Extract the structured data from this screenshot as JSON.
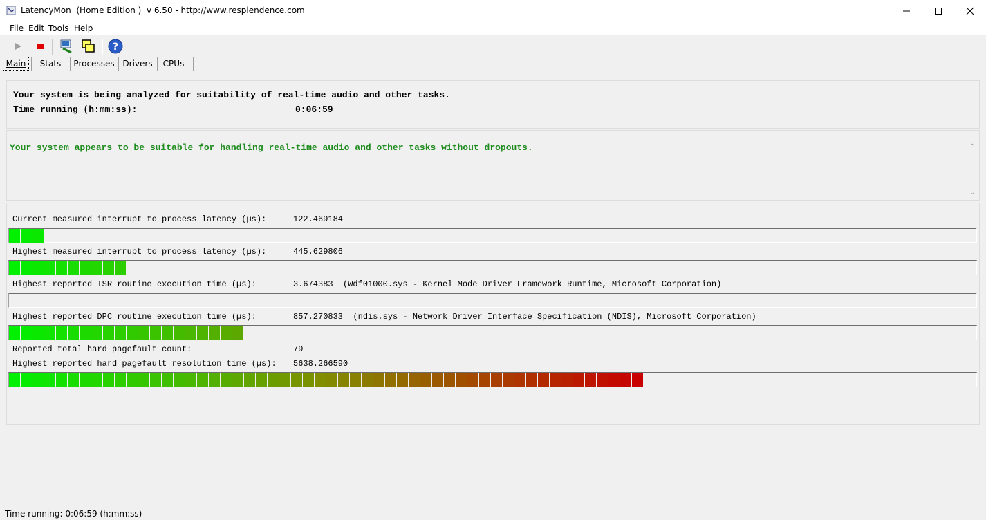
{
  "window": {
    "title": "LatencyMon  (Home Edition )  v 6.50 - http://www.resplendence.com"
  },
  "menu": {
    "file": "File",
    "edit": "Edit",
    "tools": "Tools",
    "help": "Help"
  },
  "toolbar": {
    "icons": [
      "play-icon",
      "stop-icon",
      "analyze-icon",
      "windows-icon",
      "help-icon"
    ]
  },
  "tabs": [
    "Main",
    "Stats",
    "Processes",
    "Drivers",
    "CPUs"
  ],
  "main": {
    "analysis_line": "Your system is being analyzed for suitability of real-time audio and other tasks.",
    "time_label": "Time running (h:mm:ss):",
    "time_value": "0:06:59",
    "verdict": "Your system appears to be suitable for handling real-time audio and other tasks without dropouts.",
    "verdict_color": "#1e8c1e"
  },
  "metrics": [
    {
      "label": "Current measured interrupt to process latency (µs):",
      "value": "122.469184",
      "segments": 3
    },
    {
      "label": "Highest measured interrupt to process latency (µs):",
      "value": "445.629806",
      "segments": 10
    },
    {
      "label": "Highest reported ISR routine execution time (µs):",
      "value": "3.674383  (Wdf01000.sys - Kernel Mode Driver Framework Runtime, Microsoft Corporation)",
      "segments": 0
    },
    {
      "label": "Highest reported DPC routine execution time (µs):",
      "value": "857.270833  (ndis.sys - Network Driver Interface Specification (NDIS), Microsoft Corporation)",
      "segments": 20
    }
  ],
  "pagefault": {
    "count_label": "Reported total hard pagefault count:",
    "count_value": "79",
    "time_label": "Highest reported hard pagefault resolution time (µs):",
    "time_value": "5638.266590",
    "segments": 54
  },
  "status": {
    "text": "Time running: 0:06:59  (h:mm:ss)"
  }
}
